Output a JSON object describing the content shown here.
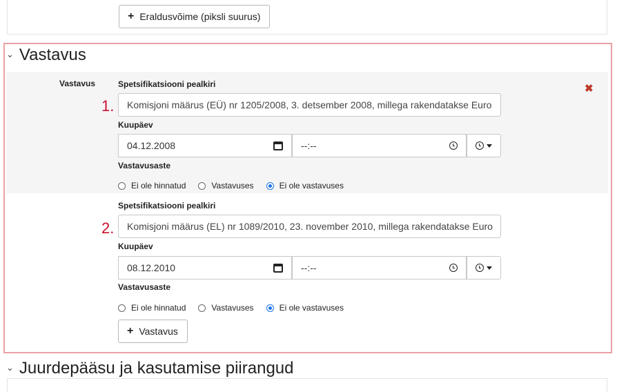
{
  "top_button": {
    "label": "Eraldusvõime (piksli suurus)"
  },
  "section": {
    "title": "Vastavus",
    "side_label": "Vastavus",
    "add_button_label": "Vastavus"
  },
  "entries": [
    {
      "number": "1.",
      "spec_title_label": "Spetsifikatsiooni pealkiri",
      "spec_title_value": "Komisjoni määrus (EÜ) nr 1205/2008, 3. detsember 2008, millega rakendatakse Euro",
      "date_label": "Kuupäev",
      "date_value": "04.12.2008",
      "time_value": "--:--",
      "degree_label": "Vastavusaste",
      "options": [
        "Ei ole hinnatud",
        "Vastavuses",
        "Ei ole vastavuses"
      ],
      "selected": "Ei ole vastavuses"
    },
    {
      "number": "2.",
      "spec_title_label": "Spetsifikatsiooni pealkiri",
      "spec_title_value": "Komisjoni määrus (EL) nr 1089/2010, 23. november 2010, millega rakendatakse Euro",
      "date_label": "Kuupäev",
      "date_value": "08.12.2010",
      "time_value": "--:--",
      "degree_label": "Vastavusaste",
      "options": [
        "Ei ole hinnatud",
        "Vastavuses",
        "Ei ole vastavuses"
      ],
      "selected": "Ei ole vastavuses"
    }
  ],
  "next_section": {
    "title": "Juurdepääsu ja kasutamise piirangud"
  },
  "icons": {
    "plus": "plus-icon",
    "chevron": "chevron-down-icon",
    "calendar": "calendar-icon",
    "clock": "clock-icon",
    "remove": "close-icon"
  },
  "colors": {
    "highlight_border": "#e8a0a4",
    "number_red": "#c8102e",
    "remove_red": "#c0392b",
    "radio_blue": "#1a73e8"
  }
}
